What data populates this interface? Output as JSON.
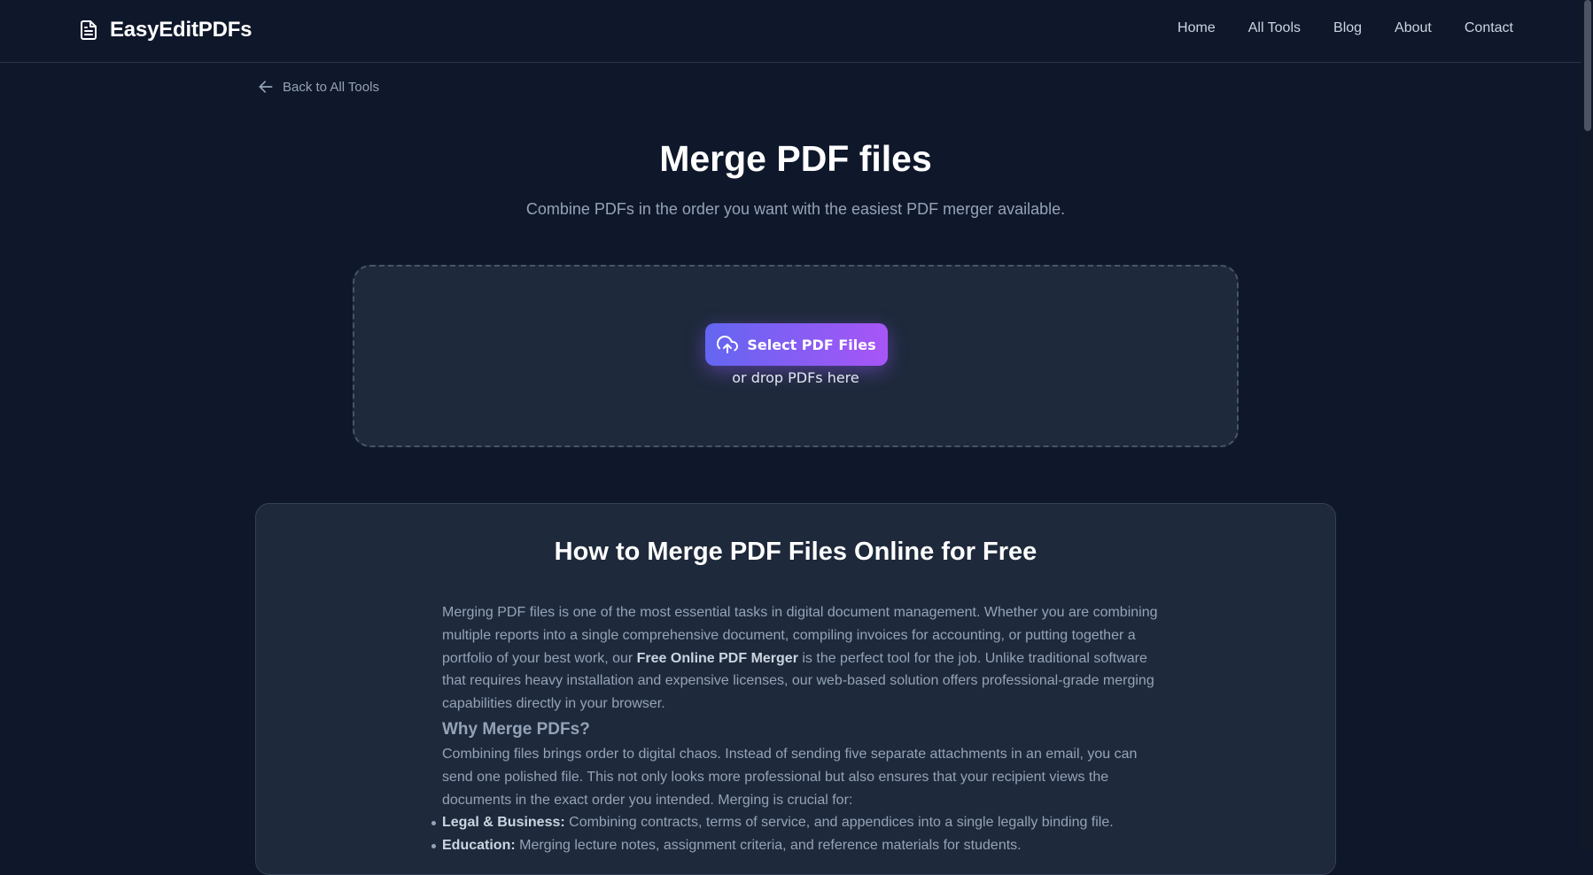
{
  "header": {
    "brand": "EasyEditPDFs",
    "brand_icon": "document-icon",
    "nav": [
      "Home",
      "All Tools",
      "Blog",
      "About",
      "Contact"
    ]
  },
  "back_link": {
    "label": "Back to All Tools",
    "icon": "arrow-left-icon"
  },
  "hero": {
    "title": "Merge PDF files",
    "subtitle": "Combine PDFs in the order you want with the easiest PDF merger available."
  },
  "dropzone": {
    "button_label": "Select PDF Files",
    "button_icon": "cloud-upload-icon",
    "hint": "or drop PDFs here",
    "button_gradient": [
      "#6366f1",
      "#a855f7"
    ]
  },
  "article": {
    "title": "How to Merge PDF Files Online for Free",
    "intro_before": "Merging PDF files is one of the most essential tasks in digital document management. Whether you are combining multiple reports into a single comprehensive document, compiling invoices for accounting, or putting together a portfolio of your best work, our ",
    "intro_bold": "Free Online PDF Merger",
    "intro_after": " is the perfect tool for the job. Unlike traditional software that requires heavy installation and expensive licenses, our web-based solution offers professional-grade merging capabilities directly in your browser.",
    "why_heading": "Why Merge PDFs?",
    "why_text": "Combining files brings order to digital chaos. Instead of sending five separate attachments in an email, you can send one polished file. This not only looks more professional but also ensures that your recipient views the documents in the exact order you intended. Merging is crucial for:",
    "uses": [
      {
        "term": "Legal & Business:",
        "text": " Combining contracts, terms of service, and appendices into a single legally binding file."
      },
      {
        "term": "Education:",
        "text": " Merging lecture notes, assignment criteria, and reference materials for students."
      }
    ]
  },
  "colors": {
    "background": "#0f172a",
    "card": "#1e293b",
    "accent": "#8b5cf6"
  }
}
